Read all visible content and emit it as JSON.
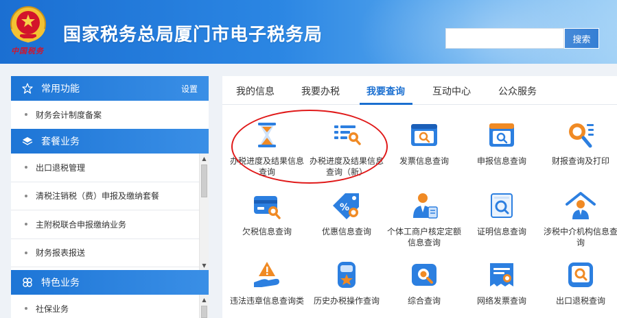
{
  "header": {
    "title": "国家税务总局厦门市电子税务局",
    "emblem_caption": "中国税务",
    "search_placeholder": "",
    "search_button": "搜索"
  },
  "sidebar": {
    "groups": [
      {
        "icon": "star-icon",
        "title": "常用功能",
        "action": "设置",
        "items": [
          "财务会计制度备案"
        ]
      },
      {
        "icon": "layers-icon",
        "title": "套餐业务",
        "items": [
          "出口退税管理",
          "清税注销税（费）申报及缴纳套餐",
          "主附税联合申报缴纳业务",
          "财务报表报送"
        ]
      },
      {
        "icon": "clover-icon",
        "title": "特色业务",
        "items": [
          "社保业务"
        ]
      }
    ]
  },
  "main": {
    "tabs": [
      {
        "label": "我的信息",
        "active": false
      },
      {
        "label": "我要办税",
        "active": false
      },
      {
        "label": "我要查询",
        "active": true
      },
      {
        "label": "互动中心",
        "active": false
      },
      {
        "label": "公众服务",
        "active": false
      }
    ],
    "tiles": [
      {
        "label": "办税进度及结果信息查询",
        "icon": "hourglass-icon"
      },
      {
        "label": "办税进度及结果信息查询（新）",
        "icon": "list-search-icon"
      },
      {
        "label": "发票信息查询",
        "icon": "invoice-search-icon"
      },
      {
        "label": "申报信息查询",
        "icon": "declaration-search-icon"
      },
      {
        "label": "财报查询及打印",
        "icon": "report-search-icon"
      },
      {
        "label": "欠税信息查询",
        "icon": "card-search-icon"
      },
      {
        "label": "优惠信息查询",
        "icon": "discount-tag-icon"
      },
      {
        "label": "个体工商户核定定额信息查询",
        "icon": "person-doc-icon"
      },
      {
        "label": "证明信息查询",
        "icon": "certificate-search-icon"
      },
      {
        "label": "涉税中介机构信息查询",
        "icon": "agency-house-icon"
      },
      {
        "label": "违法违章信息查询类",
        "icon": "warning-hand-icon"
      },
      {
        "label": "历史办税操作查询",
        "icon": "history-star-icon"
      },
      {
        "label": "综合查询",
        "icon": "comprehensive-search-icon"
      },
      {
        "label": "网络发票查询",
        "icon": "network-invoice-icon"
      },
      {
        "label": "出口退税查询",
        "icon": "export-refund-icon"
      }
    ]
  },
  "colors": {
    "primary": "#1a6fd0",
    "icon_blue": "#2c7fe0",
    "icon_orange": "#f08a24",
    "annotation_red": "#e01919"
  }
}
